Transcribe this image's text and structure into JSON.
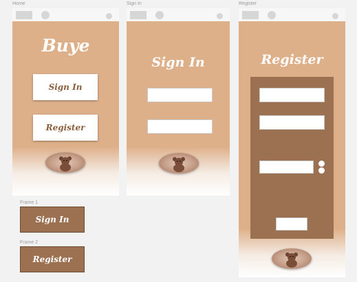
{
  "artboards": {
    "home": "Home",
    "sign_in": "Sign In",
    "register": "Register",
    "frame1": "Frame 1",
    "frame2": "Frame 2"
  },
  "home": {
    "brand": "Buye",
    "sign_in_button": "Sign In",
    "register_button": "Register"
  },
  "sign_in": {
    "title": "Sign In"
  },
  "register": {
    "title": "Register"
  },
  "frame1": {
    "label": "Sign In"
  },
  "frame2": {
    "label": "Register"
  },
  "colors": {
    "peach": "#deb08a",
    "brown_panel": "#9c7152",
    "button_text": "#8b5e3c",
    "white": "#ffffff"
  },
  "icons": {
    "teddy": "teddy-bear-icon"
  }
}
